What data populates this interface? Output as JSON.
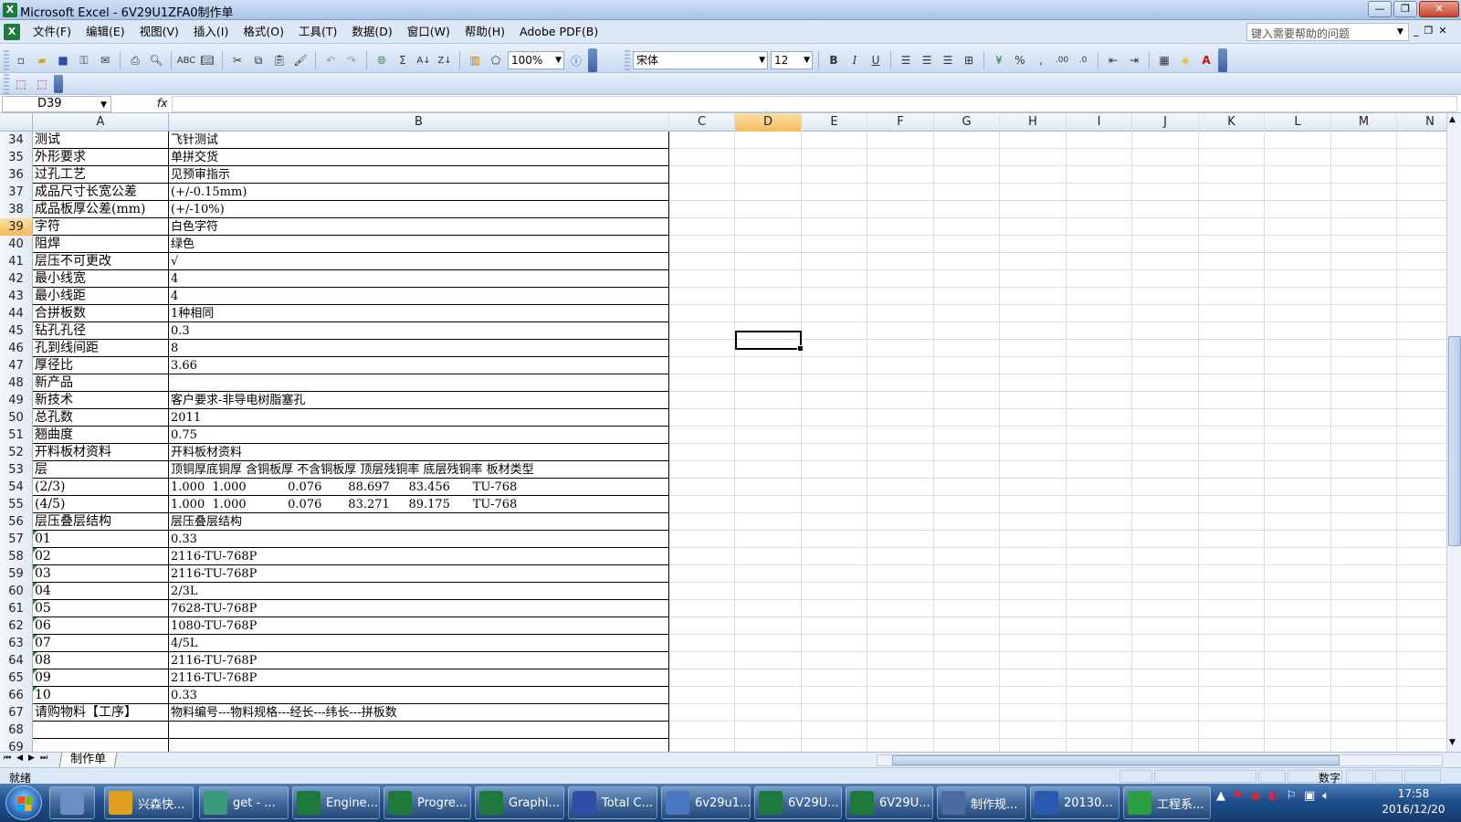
{
  "window": {
    "title": "Microsoft Excel - 6V29U1ZFA0制作单",
    "app_icon": "X"
  },
  "menu": {
    "items": [
      "文件(F)",
      "编辑(E)",
      "视图(V)",
      "插入(I)",
      "格式(O)",
      "工具(T)",
      "数据(D)",
      "窗口(W)",
      "帮助(H)",
      "Adobe PDF(B)"
    ],
    "help_placeholder": "键入需要帮助的问题"
  },
  "toolbar": {
    "zoom": "100%",
    "font_name": "宋体",
    "font_size": "12",
    "bold": "B",
    "italic": "I",
    "underline": "U",
    "percent": "%",
    "comma": ","
  },
  "formula_bar": {
    "name_box": "D39",
    "fx_label": "fx",
    "formula": ""
  },
  "columns": [
    "A",
    "B",
    "C",
    "D",
    "E",
    "F",
    "G",
    "H",
    "I",
    "J",
    "K",
    "L",
    "M",
    "N"
  ],
  "active_column": "D",
  "active_row": "39",
  "rows": [
    {
      "num": "34",
      "a": "测试",
      "b": "飞针测试"
    },
    {
      "num": "35",
      "a": "外形要求",
      "b": "单拼交货"
    },
    {
      "num": "36",
      "a": "过孔工艺",
      "b": "见预审指示"
    },
    {
      "num": "37",
      "a": "成品尺寸长宽公差",
      "b": "(+/-0.15mm)"
    },
    {
      "num": "38",
      "a": "成品板厚公差(mm)",
      "b": "(+/-10%)"
    },
    {
      "num": "39",
      "a": "字符",
      "b": "白色字符"
    },
    {
      "num": "40",
      "a": "阻焊",
      "b": "绿色"
    },
    {
      "num": "41",
      "a": "层压不可更改",
      "b": "√"
    },
    {
      "num": "42",
      "a": "最小线宽",
      "b": "4"
    },
    {
      "num": "43",
      "a": "最小线距",
      "b": "4"
    },
    {
      "num": "44",
      "a": "合拼板数",
      "b": "1种相同"
    },
    {
      "num": "45",
      "a": "钻孔孔径",
      "b": "0.3"
    },
    {
      "num": "46",
      "a": "孔到线间距",
      "b": "8"
    },
    {
      "num": "47",
      "a": "厚径比",
      "b": "3.66"
    },
    {
      "num": "48",
      "a": "新产品",
      "b": ""
    },
    {
      "num": "49",
      "a": "新技术",
      "b": "客户要求-非导电树脂塞孔"
    },
    {
      "num": "50",
      "a": "总孔数",
      "b": "2011"
    },
    {
      "num": "51",
      "a": "翘曲度",
      "b": "0.75"
    },
    {
      "num": "52",
      "a": "开料板材资料",
      "b": "开料板材资料"
    },
    {
      "num": "53",
      "a": "层",
      "b": "顶铜厚底铜厚 含铜板厚 不含铜板厚 顶层残铜率 底层残铜率 板材类型"
    },
    {
      "num": "54",
      "a": "(2/3)",
      "b": "1.000  1.000           0.076       88.697     83.456      TU-768"
    },
    {
      "num": "55",
      "a": "(4/5)",
      "b": "1.000  1.000           0.076       83.271     89.175      TU-768"
    },
    {
      "num": "56",
      "a": "层压叠层结构",
      "b": "层压叠层结构"
    },
    {
      "num": "57",
      "a": "01",
      "b": "0.33",
      "tri": true
    },
    {
      "num": "58",
      "a": "02",
      "b": "2116-TU-768P",
      "tri": true
    },
    {
      "num": "59",
      "a": "03",
      "b": "2116-TU-768P",
      "tri": true
    },
    {
      "num": "60",
      "a": "04",
      "b": "2/3L",
      "tri": true
    },
    {
      "num": "61",
      "a": "05",
      "b": "7628-TU-768P",
      "tri": true
    },
    {
      "num": "62",
      "a": "06",
      "b": "1080-TU-768P",
      "tri": true
    },
    {
      "num": "63",
      "a": "07",
      "b": "4/5L",
      "tri": true
    },
    {
      "num": "64",
      "a": "08",
      "b": "2116-TU-768P",
      "tri": true
    },
    {
      "num": "65",
      "a": "09",
      "b": "2116-TU-768P",
      "tri": true
    },
    {
      "num": "66",
      "a": "10",
      "b": "0.33",
      "tri": true
    },
    {
      "num": "67",
      "a": "请购物料【工序】",
      "b": "物料编号---物料规格---经长---纬长---拼板数"
    },
    {
      "num": "68",
      "a": "",
      "b": ""
    },
    {
      "num": "69",
      "a": "",
      "b": ""
    }
  ],
  "sheet_tab": "制作单",
  "status": {
    "ready": "就绪",
    "numlock": "数字"
  },
  "taskbar": {
    "items": [
      {
        "label": "",
        "icon": "calculator-icon",
        "color": "#6b8fc2"
      },
      {
        "label": "兴森快...",
        "icon": "flower-icon",
        "color": "#e0a020"
      },
      {
        "label": "get - ...",
        "icon": "eye-icon",
        "color": "#3a9a7a"
      },
      {
        "label": "Engine...",
        "icon": "excel-icon",
        "color": "#1d7a3a"
      },
      {
        "label": "Progre...",
        "icon": "excel-icon",
        "color": "#1d7a3a"
      },
      {
        "label": "Graphi...",
        "icon": "excel-icon",
        "color": "#1d7a3a"
      },
      {
        "label": "Total C...",
        "icon": "floppy-icon",
        "color": "#2d4fa8"
      },
      {
        "label": "6v29u1...",
        "icon": "doc-icon",
        "color": "#4a78c0"
      },
      {
        "label": "6V29U...",
        "icon": "excel-icon",
        "color": "#1d7a3a"
      },
      {
        "label": "6V29U...",
        "icon": "excel-icon",
        "color": "#1d7a3a"
      },
      {
        "label": "制作规...",
        "icon": "notepad-icon",
        "color": "#4a6aa0"
      },
      {
        "label": "20130...",
        "icon": "word-icon",
        "color": "#2a5ab0"
      },
      {
        "label": "工程系...",
        "icon": "app-icon",
        "color": "#2aa040"
      }
    ],
    "time": "17:58",
    "date": "2016/12/20"
  }
}
